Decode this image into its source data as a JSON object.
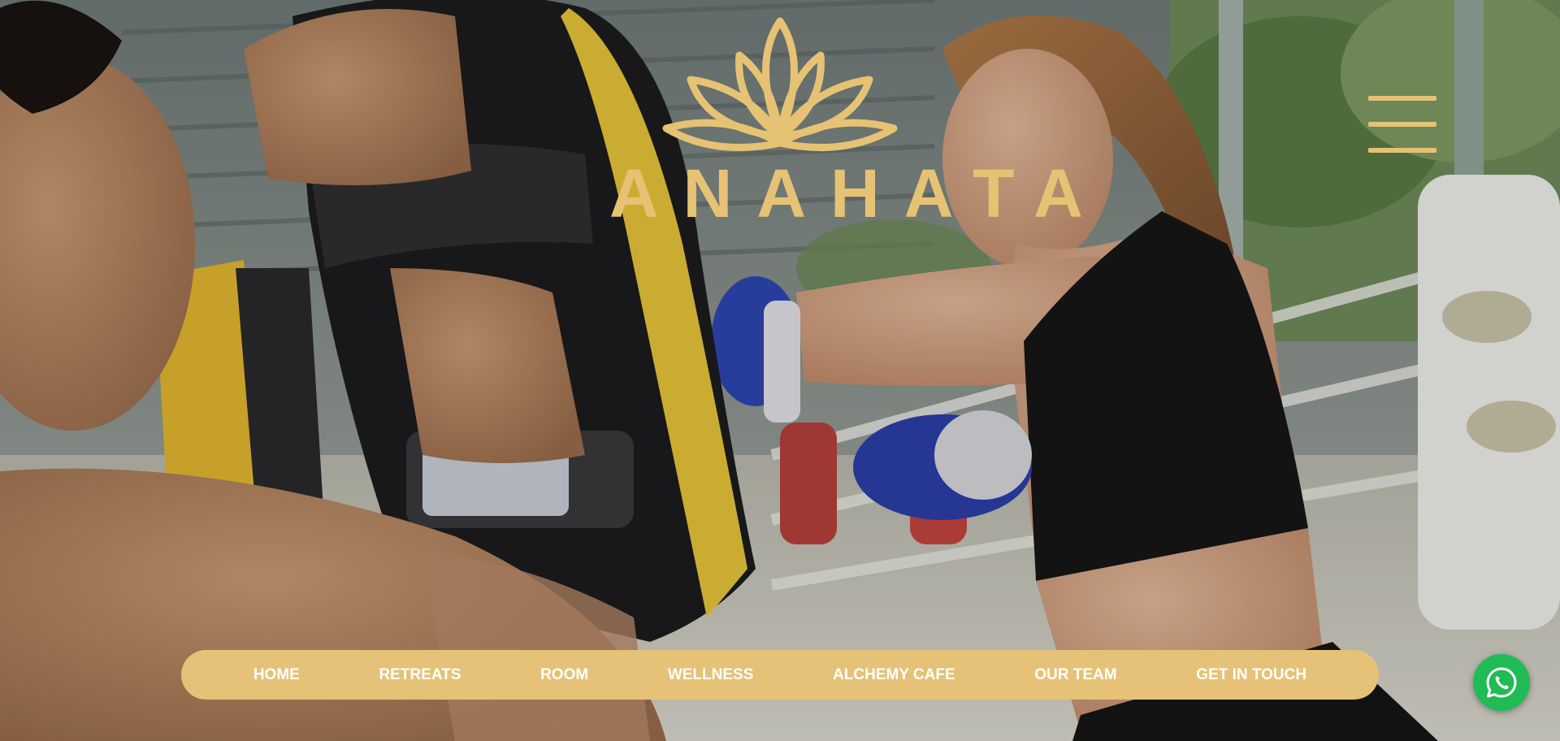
{
  "brand": {
    "name": "ANAHATA",
    "logo_icon": "lotus-icon",
    "accent_color": "#e6c274"
  },
  "header": {
    "menu_icon": "hamburger-menu-icon"
  },
  "hero": {
    "media": "muay-thai-training-video"
  },
  "nav": {
    "background_color": "#e5c277",
    "items": [
      {
        "label": "HOME"
      },
      {
        "label": "RETREATS"
      },
      {
        "label": "ROOM"
      },
      {
        "label": "WELLNESS"
      },
      {
        "label": "ALCHEMY CAFE"
      },
      {
        "label": "OUR TEAM"
      },
      {
        "label": "GET IN TOUCH"
      }
    ]
  },
  "whatsapp": {
    "icon": "whatsapp-icon",
    "color": "#21bb55"
  }
}
